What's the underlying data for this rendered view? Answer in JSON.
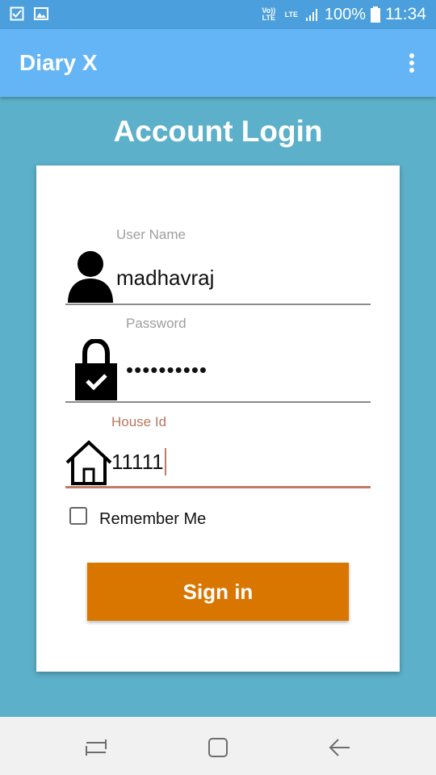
{
  "status_bar": {
    "volte": "Vo)) LTE",
    "lte": "LTE",
    "battery": "100%",
    "time": "11:34",
    "icons": [
      "checkbox-notification-icon",
      "image-notification-icon",
      "signal-icon",
      "battery-icon"
    ]
  },
  "app_bar": {
    "title": "Diary X",
    "menu_icon": "overflow-menu-icon"
  },
  "page_title": "Account Login",
  "form": {
    "username": {
      "label": "User Name",
      "value": "madhavraj",
      "icon": "person-icon"
    },
    "password": {
      "label": "Password",
      "value": "••••••••••",
      "icon": "lock-icon"
    },
    "house_id": {
      "label": "House Id",
      "value": "11111",
      "icon": "house-icon"
    },
    "remember": {
      "label": "Remember Me",
      "checked": false
    },
    "submit_label": "Sign in"
  },
  "colors": {
    "background": "#5cb0c9",
    "app_bar": "#64b5f6",
    "status_bar": "#4a9fdc",
    "button": "#d97600",
    "active_accent": "#c07b66"
  },
  "nav_bar": {
    "buttons": [
      "recents-icon",
      "home-icon",
      "back-icon"
    ]
  }
}
